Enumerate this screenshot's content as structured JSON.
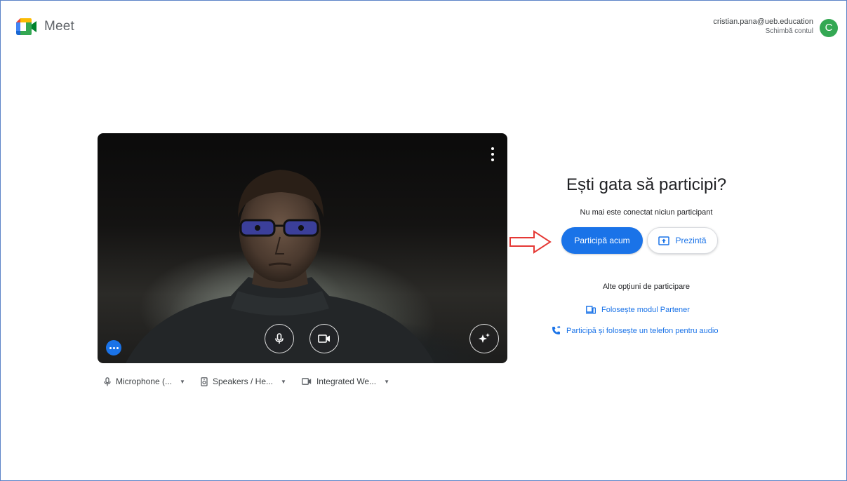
{
  "header": {
    "app_name": "Meet",
    "account_email": "cristian.pana@ueb.education",
    "switch_account_label": "Schimbă contul",
    "avatar_letter": "C",
    "avatar_color": "#34a853"
  },
  "preview": {
    "options_icon": "more-vert-icon",
    "mic_icon": "microphone-icon",
    "camera_icon": "videocam-icon",
    "effects_icon": "sparkle-icon",
    "more_icon": "more-horiz-icon"
  },
  "devices": {
    "microphone": "Microphone (...",
    "speakers": "Speakers / He...",
    "camera": "Integrated We..."
  },
  "join_panel": {
    "title": "Ești gata să participi?",
    "subtitle": "Nu mai este conectat niciun participant",
    "join_button": "Participă acum",
    "present_button": "Prezintă",
    "other_options": "Alte opțiuni de participare",
    "partner_mode_link": "Folosește modul Partener",
    "phone_audio_link": "Participă și folosește un telefon pentru audio"
  },
  "colors": {
    "accent": "#1a73e8",
    "annotation_arrow": "#e53935"
  }
}
